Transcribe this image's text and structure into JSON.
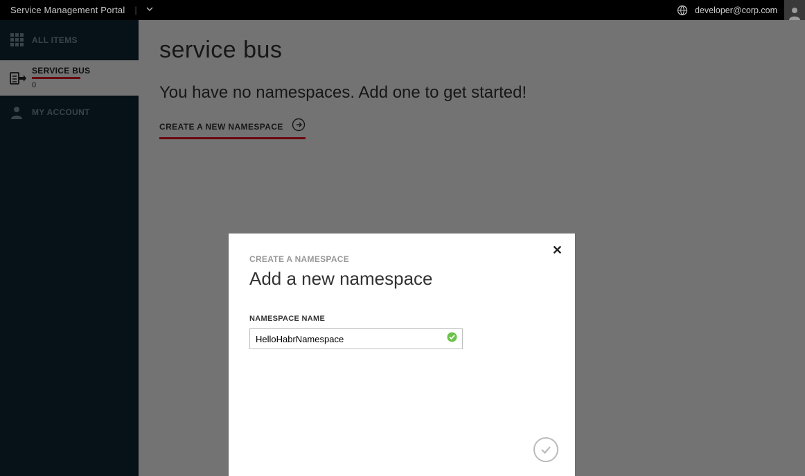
{
  "header": {
    "title": "Service Management Portal",
    "user_email": "developer@corp.com"
  },
  "sidebar": {
    "items": [
      {
        "label": "ALL ITEMS"
      },
      {
        "label": "SERVICE BUS",
        "count": "0"
      },
      {
        "label": "MY ACCOUNT"
      }
    ]
  },
  "main": {
    "title": "service bus",
    "empty_message": "You have no namespaces. Add one to get started!",
    "create_link_label": "CREATE A NEW NAMESPACE"
  },
  "dialog": {
    "breadcrumb": "CREATE A NAMESPACE",
    "title": "Add a new namespace",
    "field_label": "NAMESPACE NAME",
    "field_value": "HelloHabrNamespace"
  }
}
